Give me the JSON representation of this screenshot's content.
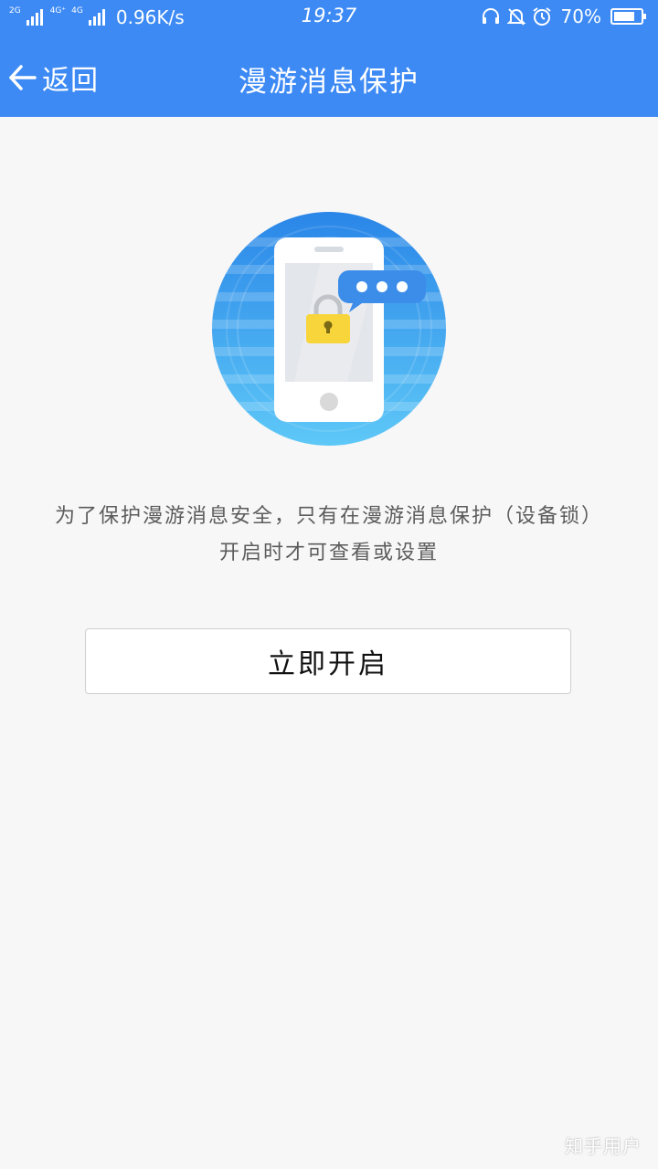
{
  "colors": {
    "header_bg": "#3d8af5",
    "page_bg": "#f7f7f7",
    "text_muted": "#5c5c5c",
    "lock_yellow": "#f8d53a"
  },
  "status_bar": {
    "network_1": "2G",
    "network_2": "4G⁺",
    "network_3": "4G",
    "speed": "0.96K/s",
    "time": "19:37",
    "battery": "70%",
    "icons": [
      "headset-icon",
      "bell-muted-icon",
      "alarm-icon",
      "battery-icon"
    ]
  },
  "header": {
    "back_label": "返回",
    "title": "漫游消息保护",
    "back_icon": "arrow-left-icon"
  },
  "hero": {
    "icon": "phone-lock-illustration"
  },
  "description": {
    "line1": "为了保护漫游消息安全，只有在漫游消息保护（设备锁）",
    "line2": "开启时才可查看或设置"
  },
  "actions": {
    "enable_label": "立即开启"
  },
  "watermark": "知乎用户"
}
